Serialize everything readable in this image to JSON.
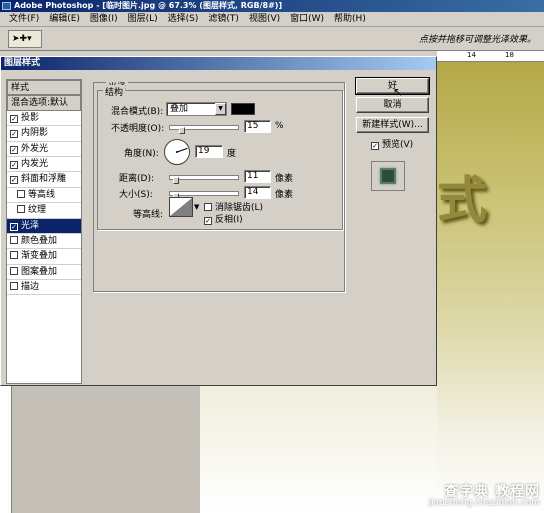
{
  "app": {
    "title": "Adobe Photoshop - [临时图片.jpg @ 67.3% (图层样式, RGB/8#)]"
  },
  "menu": [
    "文件(F)",
    "编辑(E)",
    "图像(I)",
    "图层(L)",
    "选择(S)",
    "滤镜(T)",
    "视图(V)",
    "窗口(W)",
    "帮助(H)"
  ],
  "options_bar": {
    "hint": "点按并拖移可调整光泽效果。"
  },
  "ruler": {
    "ticks": [
      "14",
      "18"
    ]
  },
  "document": {
    "text": "式"
  },
  "dialog": {
    "title": "图层样式",
    "style_list": {
      "header": "样式",
      "blend_default": "混合选项:默认",
      "items": [
        {
          "label": "投影",
          "checked": true,
          "indent": false
        },
        {
          "label": "内阴影",
          "checked": true,
          "indent": false
        },
        {
          "label": "外发光",
          "checked": true,
          "indent": false
        },
        {
          "label": "内发光",
          "checked": true,
          "indent": false
        },
        {
          "label": "斜面和浮雕",
          "checked": true,
          "indent": false
        },
        {
          "label": "等高线",
          "checked": false,
          "indent": true
        },
        {
          "label": "纹理",
          "checked": false,
          "indent": true
        },
        {
          "label": "光泽",
          "checked": true,
          "indent": false,
          "selected": true
        },
        {
          "label": "颜色叠加",
          "checked": false,
          "indent": false
        },
        {
          "label": "渐变叠加",
          "checked": false,
          "indent": false
        },
        {
          "label": "图案叠加",
          "checked": false,
          "indent": false
        },
        {
          "label": "描边",
          "checked": false,
          "indent": false
        }
      ]
    },
    "satin": {
      "group_label": "光泽",
      "structure_label": "结构",
      "blend_mode_label": "混合模式(B):",
      "blend_mode_value": "叠加",
      "swatch_color": "#000000",
      "opacity_label": "不透明度(O):",
      "opacity_value": "15",
      "opacity_unit": "%",
      "opacity_fraction": 0.15,
      "angle_label": "角度(N):",
      "angle_value": "19",
      "angle_unit": "度",
      "distance_label": "距离(D):",
      "distance_value": "11",
      "distance_unit": "像素",
      "distance_fraction": 0.045,
      "size_label": "大小(S):",
      "size_value": "14",
      "size_unit": "像素",
      "size_fraction": 0.056,
      "contour_label": "等高线:",
      "antialias_label": "消除锯齿(L)",
      "antialias_checked": false,
      "invert_label": "反相(I)",
      "invert_checked": true
    },
    "buttons": {
      "ok": "好",
      "cancel": "取消",
      "new_style": "新建样式(W)...",
      "preview_label": "预览(V)",
      "preview_checked": true
    }
  },
  "watermark": {
    "line1": "查字典 教程网",
    "line2": "jiaocheng.chazidian.com"
  }
}
